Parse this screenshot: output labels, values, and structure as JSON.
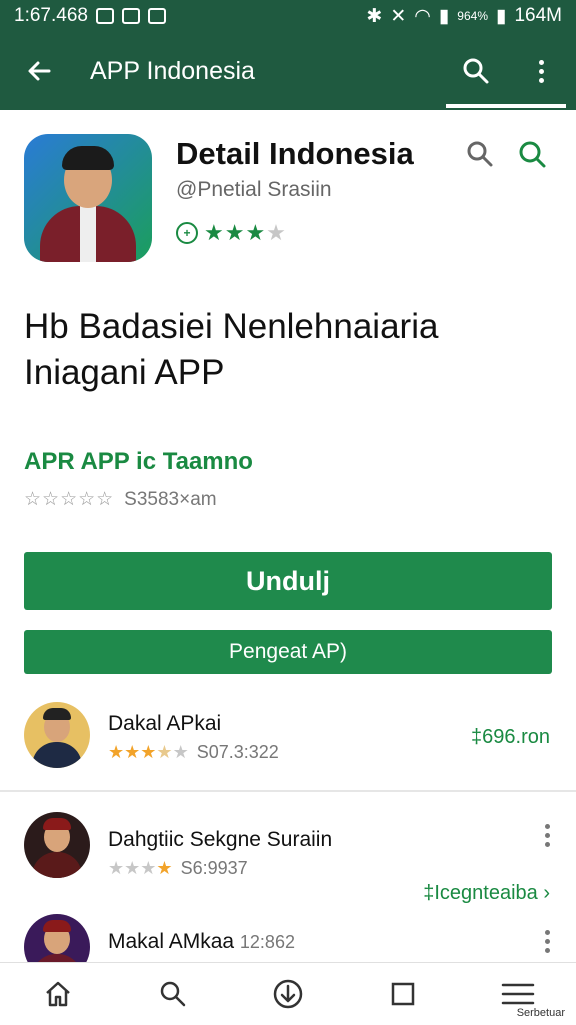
{
  "status_bar": {
    "time": "1:67.468",
    "battery_text": "964%",
    "signal_text": "164M"
  },
  "app_bar": {
    "title": "APP Indonesia",
    "back_icon": "arrow-left-icon",
    "search_icon": "search-icon",
    "more_icon": "more-vert-icon"
  },
  "app_header": {
    "title": "Detail Indonesia",
    "subtitle": "@Pnetial Srasiin",
    "rating": {
      "value": 3,
      "max": 4
    }
  },
  "headline": {
    "line1": "Hb Badasiei Nenlehnaiaria",
    "line2": "Iniagani APP"
  },
  "tagline": "APR APP ic Taamno",
  "meta": {
    "stars": "☆☆☆☆☆",
    "count": "S3583×am"
  },
  "buttons": {
    "primary": "Undulj",
    "secondary": "Pengeat AP)"
  },
  "list": [
    {
      "name": "Dakal APkai",
      "rating": "S07.3:322",
      "stars_on": 3,
      "stars_half": 1,
      "right_link": "‡696.ron"
    },
    {
      "name": "Dahgtiic Sekgne Suraiin",
      "rating": "S6:9937",
      "stars_on": 1,
      "stars_half": 0,
      "right_link": "‡Icegnteaiba ›"
    },
    {
      "name": "Makal AMkaa",
      "rating": "12:862",
      "stars_on": 0,
      "stars_half": 0,
      "right_link": ""
    }
  ],
  "bottom_nav": {
    "items": [
      "home-icon",
      "search-icon",
      "download-icon",
      "recents-icon",
      "menu-icon"
    ],
    "caption": "Serbetuar"
  },
  "colors": {
    "primary": "#1f5a40",
    "accent": "#1a8a42",
    "button": "#1f8a4c",
    "star_yellow": "#f2a32a"
  }
}
